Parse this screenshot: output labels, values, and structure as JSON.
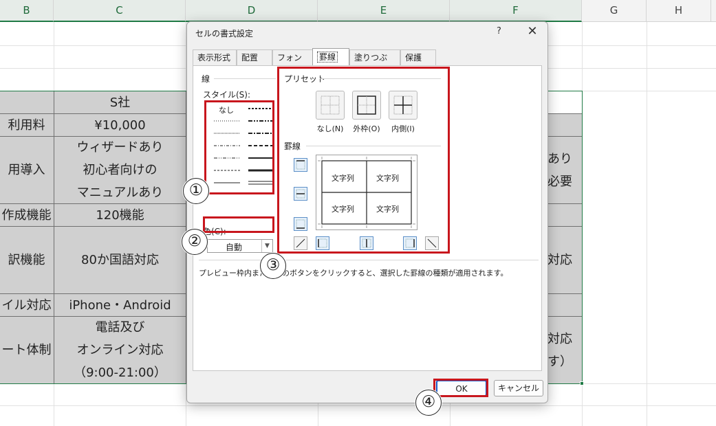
{
  "columns": [
    "B",
    "C",
    "D",
    "E",
    "F",
    "G",
    "H"
  ],
  "table": {
    "header_c": "S社",
    "rows": [
      {
        "label": "利用料",
        "c": [
          "¥10,000"
        ],
        "f": []
      },
      {
        "label": "用導入",
        "c": [
          "ウィザードあり",
          "初心者向けの",
          "マニュアルあり"
        ],
        "f": [
          "あり",
          "必要"
        ]
      },
      {
        "label": "作成機能",
        "c": [
          "120機能"
        ],
        "f": []
      },
      {
        "label": "訳機能",
        "c": [
          "80か国語対応"
        ],
        "f": [
          "対応"
        ]
      },
      {
        "label": "イル対応",
        "c": [
          "iPhone・Android"
        ],
        "f": []
      },
      {
        "label": "ート体制",
        "c": [
          "電話及び",
          "オンライン対応",
          "（9:00-21:00）"
        ],
        "f": [
          "対応",
          "す）"
        ]
      }
    ]
  },
  "dialog": {
    "title": "セルの書式設定",
    "help": "?",
    "close": "✕",
    "tabs": [
      "表示形式",
      "配置",
      "フォント",
      "罫線",
      "塗りつぶし",
      "保護"
    ],
    "active_tab": "罫線",
    "line_group": "線",
    "style_label": "スタイル(S):",
    "style_none": "なし",
    "color_label": "色(C):",
    "color_value": "自動",
    "preset_group": "プリセット",
    "presets": [
      "なし(N)",
      "外枠(O)",
      "内側(I)"
    ],
    "border_group": "罫線",
    "preview_text": [
      "文字列",
      "文字列",
      "文字列",
      "文字列"
    ],
    "hint": "プレビュー枠内または上のボタンをクリックすると、選択した罫線の種類が適用されます。",
    "ok": "OK",
    "cancel": "キャンセル"
  },
  "annotations": [
    "①",
    "②",
    "③",
    "④"
  ],
  "colors": {
    "annotation": "#c8161d",
    "selection": "#1f7a45",
    "cell_gray": "#d0d0d0"
  }
}
